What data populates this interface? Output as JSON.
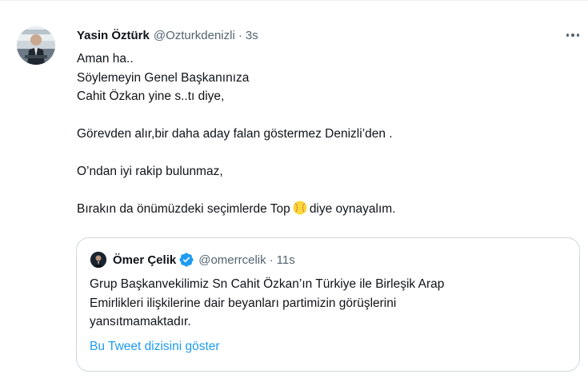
{
  "tweet": {
    "author_name": "Yasin Öztürk",
    "author_handle": "@Ozturkdenizli",
    "separator": "·",
    "time": "3s",
    "lines": [
      "Aman ha..",
      "Söylemeyin Genel Başkanınıza",
      "Cahit Özkan yine s..tı diye,",
      "",
      "Görevden alır,bir daha aday falan göstermez Denizli’den .",
      "",
      "O’ndan iyi rakip bulunmaz,",
      ""
    ],
    "last_line_before": "Bırakın da önümüzdeki seçimlerde Top",
    "emoji_icon": "softball-emoji",
    "last_line_after": "diye oynayalım."
  },
  "quoted": {
    "author_name": "Ömer Çelik",
    "verified_icon": "verified-badge-icon",
    "author_handle": "@omerrcelik",
    "separator": "·",
    "time": "11s",
    "lines": [
      "Grup Başkanvekilimiz Sn Cahit Özkan’ın Türkiye ile Birleşik Arap",
      "Emirlikleri ilişkilerine dair beyanları partimizin görüşlerini",
      "yansıtmamaktadır."
    ],
    "show_thread": "Bu Tweet dizisini göster"
  },
  "colors": {
    "text": "#0f1419",
    "secondary": "#536471",
    "link": "#1d9bf0",
    "border": "#cfd9de"
  }
}
